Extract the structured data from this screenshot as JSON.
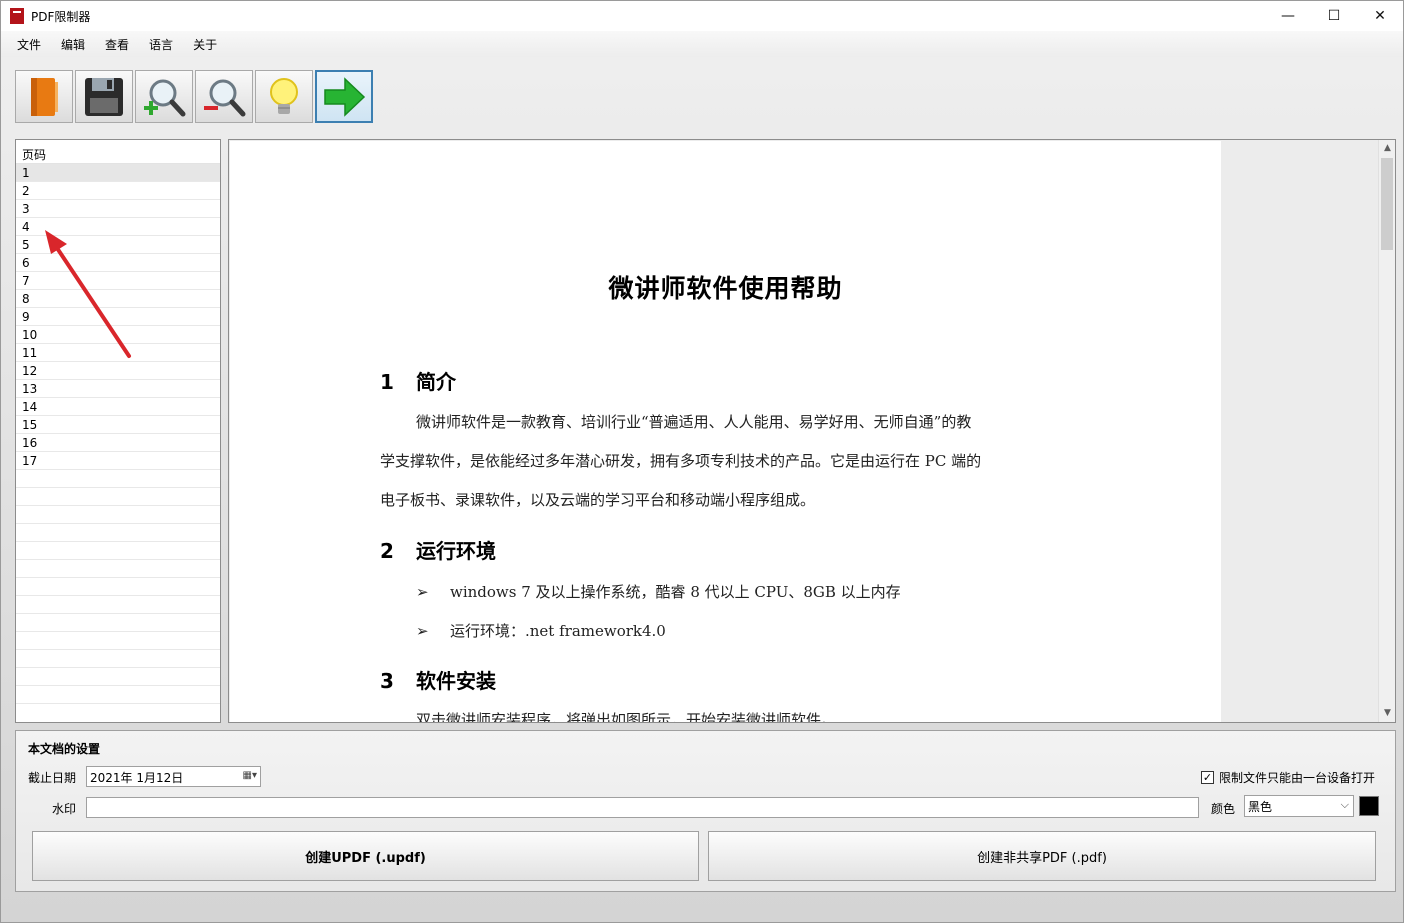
{
  "window": {
    "title": "PDF限制器",
    "controls": {
      "minimize": "—",
      "maximize": "☐",
      "close": "✕"
    }
  },
  "menu": [
    "文件",
    "编辑",
    "查看",
    "语言",
    "关于"
  ],
  "toolbar": [
    {
      "name": "open-book-icon"
    },
    {
      "name": "save-disk-icon"
    },
    {
      "name": "zoom-in-icon"
    },
    {
      "name": "zoom-out-icon"
    },
    {
      "name": "lightbulb-icon"
    },
    {
      "name": "green-arrow-icon"
    }
  ],
  "pagelist": {
    "header": "页码",
    "pages": [
      "1",
      "2",
      "3",
      "4",
      "5",
      "6",
      "7",
      "8",
      "9",
      "10",
      "11",
      "12",
      "13",
      "14",
      "15",
      "16",
      "17"
    ],
    "selected_index": 0,
    "empty_rows": 13
  },
  "document": {
    "title": "微讲师软件使用帮助",
    "sections": [
      {
        "num": "1",
        "heading": "简介"
      },
      {
        "num": "2",
        "heading": "运行环境"
      },
      {
        "num": "3",
        "heading": "软件安装"
      }
    ],
    "intro_lines": [
      "微讲师软件是一款教育、培训行业“普遍适用、人人能用、易学好用、无师自通”的教",
      "学支撑软件，是依能经过多年潜心研发，拥有多项专利技术的产品。它是由运行在 PC 端的",
      "电子板书、录课软件，以及云端的学习平台和移动端小程序组成。"
    ],
    "bullets": [
      "windows 7 及以上操作系统，酷睿 8 代以上 CPU、8GB 以上内存",
      "运行环境：.net framework4.0"
    ],
    "bullet_mark": "➢",
    "cutoff_line": "双击微讲师安装程序，将弹出如图所示，开始安装微讲师软件。"
  },
  "settings": {
    "title": "本文档的设置",
    "date_label": "截止日期",
    "date_value": "2021年  1月12日",
    "watermark_label": "水印",
    "watermark_value": "",
    "color_label": "颜色",
    "color_value": "黑色",
    "swatch_color": "#000000",
    "restrict_label": "限制文件只能由一台设备打开",
    "restrict_checked": "☑",
    "btn_updf": "创建UPDF (.updf)",
    "btn_pdf": "创建非共享PDF (.pdf)"
  }
}
